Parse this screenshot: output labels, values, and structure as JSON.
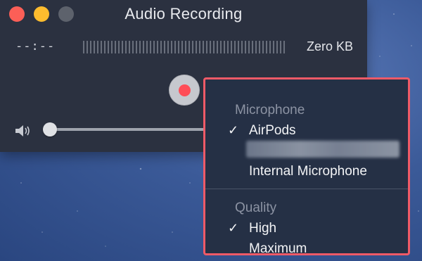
{
  "window": {
    "title": "Audio Recording",
    "time_display": "--:--",
    "file_size": "Zero KB"
  },
  "volume": {
    "level": 0.0
  },
  "menu": {
    "microphone_header": "Microphone",
    "microphone_items": [
      {
        "label": "AirPods",
        "checked": true
      },
      {
        "label": "",
        "checked": false,
        "obscured": true
      },
      {
        "label": "Internal Microphone",
        "checked": false
      }
    ],
    "quality_header": "Quality",
    "quality_items": [
      {
        "label": "High",
        "checked": true
      },
      {
        "label": "Maximum",
        "checked": false
      }
    ],
    "check_mark": "✓"
  },
  "colors": {
    "highlight_border": "#f05a67",
    "record_dot": "#ff4d57"
  }
}
